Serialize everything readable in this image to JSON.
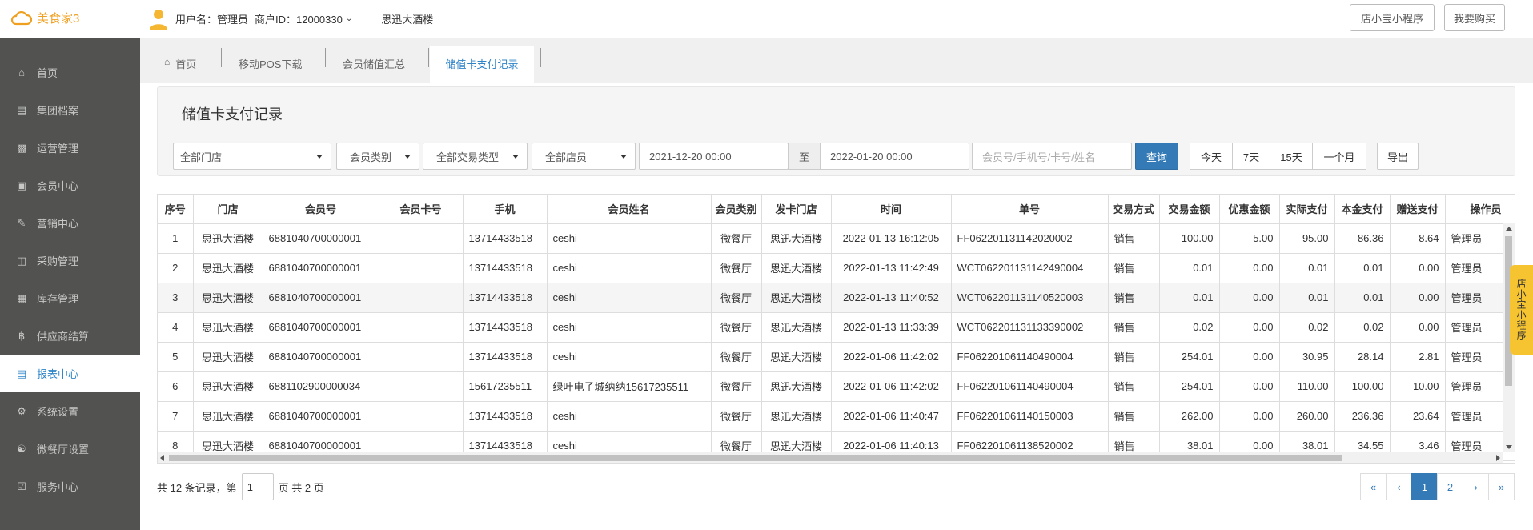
{
  "brand": {
    "name": "美食家3",
    "color": "#f0a020"
  },
  "header": {
    "user_label": "用户名：管理员",
    "merchant_label": "商户ID：12000330",
    "store_name": "思迅大酒楼",
    "btn_mini": "店小宝小程序",
    "btn_buy": "我要购买"
  },
  "sidebar": {
    "items": [
      {
        "label": "首页",
        "icon": "home-icon"
      },
      {
        "label": "集团档案",
        "icon": "file-icon"
      },
      {
        "label": "运营管理",
        "icon": "bar-chart-icon"
      },
      {
        "label": "会员中心",
        "icon": "id-card-icon"
      },
      {
        "label": "营销中心",
        "icon": "edit-icon"
      },
      {
        "label": "采购管理",
        "icon": "book-icon"
      },
      {
        "label": "库存管理",
        "icon": "storage-icon"
      },
      {
        "label": "供应商结算",
        "icon": "bitcoin-icon"
      },
      {
        "label": "报表中心",
        "icon": "report-icon"
      },
      {
        "label": "系统设置",
        "icon": "gears-icon"
      },
      {
        "label": "微餐厅设置",
        "icon": "cutlery-icon"
      },
      {
        "label": "服务中心",
        "icon": "checkbox-icon"
      }
    ],
    "active_index": 8
  },
  "tabs": [
    {
      "label": "首页"
    },
    {
      "label": "移动POS下载"
    },
    {
      "label": "会员储值汇总"
    },
    {
      "label": "储值卡支付记录"
    }
  ],
  "panel_title": "储值卡支付记录",
  "filters": {
    "store": "全部门店",
    "member_type": "会员类别",
    "trade_type": "全部交易类型",
    "clerk": "全部店员",
    "date_from": "2021-12-20 00:00",
    "date_sep": "至",
    "date_to": "2022-01-20 00:00",
    "search_placeholder": "会员号/手机号/卡号/姓名",
    "query": "查询",
    "today": "今天",
    "d7": "7天",
    "d15": "15天",
    "month": "一个月",
    "export": "导出"
  },
  "table": {
    "headers": [
      "序号",
      "门店",
      "会员号",
      "会员卡号",
      "手机",
      "会员姓名",
      "会员类别",
      "发卡门店",
      "时间",
      "单号",
      "交易方式",
      "交易金额",
      "优惠金额",
      "实际支付",
      "本金支付",
      "赠送支付",
      "操作员"
    ],
    "rows": [
      [
        "1",
        "思迅大酒楼",
        "6881040700000001",
        "",
        "13714433518",
        "ceshi",
        "微餐厅",
        "思迅大酒楼",
        "2022-01-13 16:12:05",
        "FF062201131142020002",
        "销售",
        "100.00",
        "5.00",
        "95.00",
        "86.36",
        "8.64",
        "管理员"
      ],
      [
        "2",
        "思迅大酒楼",
        "6881040700000001",
        "",
        "13714433518",
        "ceshi",
        "微餐厅",
        "思迅大酒楼",
        "2022-01-13 11:42:49",
        "WCT062201131142490004",
        "销售",
        "0.01",
        "0.00",
        "0.01",
        "0.01",
        "0.00",
        "管理员"
      ],
      [
        "3",
        "思迅大酒楼",
        "6881040700000001",
        "",
        "13714433518",
        "ceshi",
        "微餐厅",
        "思迅大酒楼",
        "2022-01-13 11:40:52",
        "WCT062201131140520003",
        "销售",
        "0.01",
        "0.00",
        "0.01",
        "0.01",
        "0.00",
        "管理员"
      ],
      [
        "4",
        "思迅大酒楼",
        "6881040700000001",
        "",
        "13714433518",
        "ceshi",
        "微餐厅",
        "思迅大酒楼",
        "2022-01-13 11:33:39",
        "WCT062201131133390002",
        "销售",
        "0.02",
        "0.00",
        "0.02",
        "0.02",
        "0.00",
        "管理员"
      ],
      [
        "5",
        "思迅大酒楼",
        "6881040700000001",
        "",
        "13714433518",
        "ceshi",
        "微餐厅",
        "思迅大酒楼",
        "2022-01-06 11:42:02",
        "FF062201061140490004",
        "销售",
        "254.01",
        "0.00",
        "30.95",
        "28.14",
        "2.81",
        "管理员"
      ],
      [
        "6",
        "思迅大酒楼",
        "6881102900000034",
        "",
        "15617235511",
        "绿叶电子城纳纳15617235511",
        "微餐厅",
        "思迅大酒楼",
        "2022-01-06 11:42:02",
        "FF062201061140490004",
        "销售",
        "254.01",
        "0.00",
        "110.00",
        "100.00",
        "10.00",
        "管理员"
      ],
      [
        "7",
        "思迅大酒楼",
        "6881040700000001",
        "",
        "13714433518",
        "ceshi",
        "微餐厅",
        "思迅大酒楼",
        "2022-01-06 11:40:47",
        "FF062201061140150003",
        "销售",
        "262.00",
        "0.00",
        "260.00",
        "236.36",
        "23.64",
        "管理员"
      ],
      [
        "8",
        "思迅大酒楼",
        "6881040700000001",
        "",
        "13714433518",
        "ceshi",
        "微餐厅",
        "思迅大酒楼",
        "2022-01-06 11:40:13",
        "FF062201061138520002",
        "销售",
        "38.01",
        "0.00",
        "38.01",
        "34.55",
        "3.46",
        "管理员"
      ]
    ]
  },
  "footer": {
    "total_prefix": "共 12 条记录，第",
    "page_value": "1",
    "page_suffix": "页 共 2 页"
  },
  "pager": {
    "first": "«",
    "prev": "‹",
    "p1": "1",
    "p2": "2",
    "next": "›",
    "last": "»"
  },
  "float_tag": "店小宝小程序"
}
